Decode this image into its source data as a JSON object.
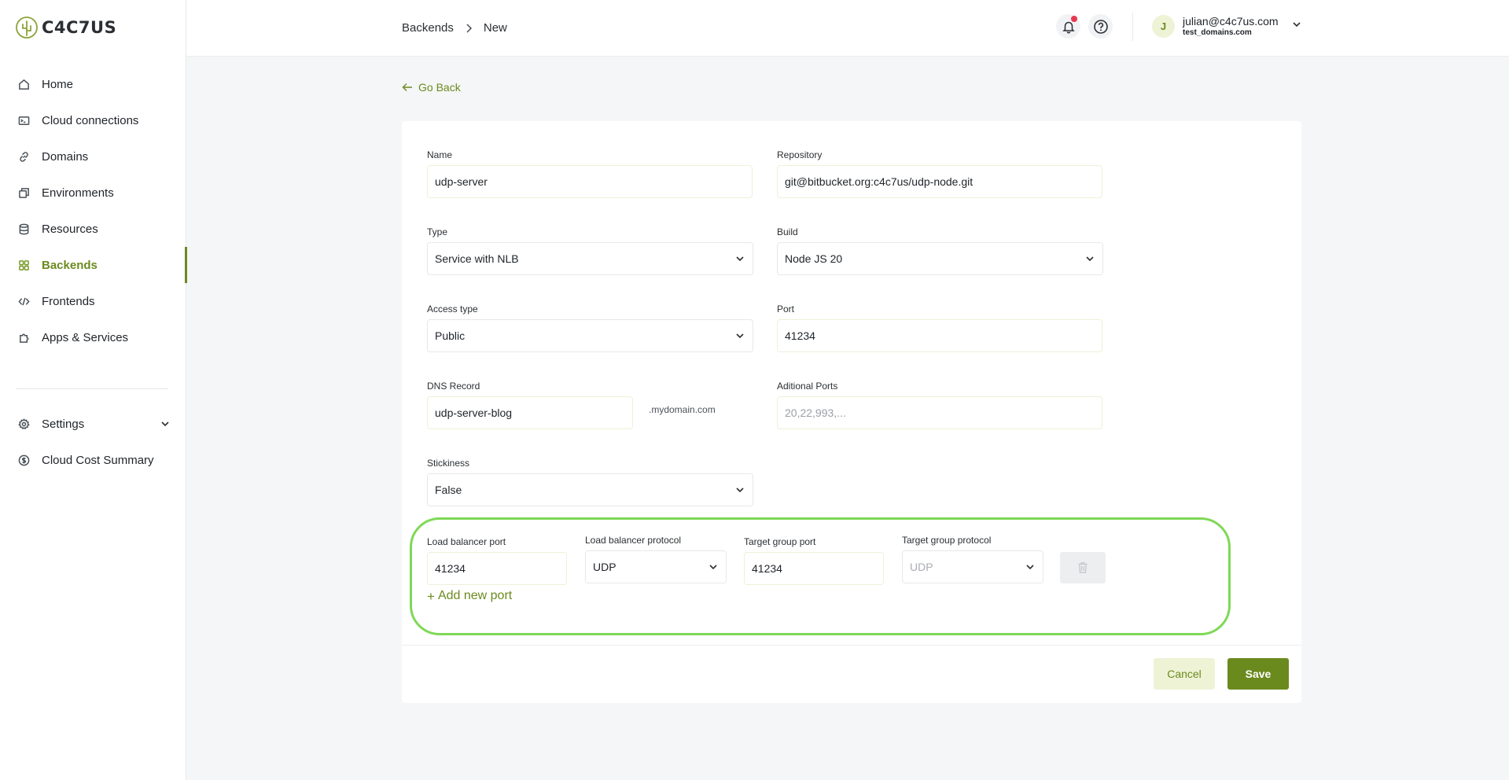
{
  "app": {
    "logo_text": "C4C7US"
  },
  "sidebar": {
    "items": [
      {
        "label": "Home",
        "icon": "home-icon"
      },
      {
        "label": "Cloud connections",
        "icon": "terminal-icon"
      },
      {
        "label": "Domains",
        "icon": "link-icon"
      },
      {
        "label": "Environments",
        "icon": "layers-icon"
      },
      {
        "label": "Resources",
        "icon": "database-icon"
      },
      {
        "label": "Backends",
        "icon": "grid-icon",
        "active": true
      },
      {
        "label": "Frontends",
        "icon": "code-icon"
      },
      {
        "label": "Apps & Services",
        "icon": "puzzle-icon"
      }
    ],
    "secondary": [
      {
        "label": "Settings",
        "icon": "gear-icon"
      },
      {
        "label": "Cloud Cost Summary",
        "icon": "dollar-icon"
      }
    ]
  },
  "header": {
    "breadcrumb": [
      "Backends",
      "New"
    ],
    "user": {
      "initial": "J",
      "email": "julian@c4c7us.com",
      "domain": "test_domains.com"
    }
  },
  "form": {
    "go_back": "Go Back",
    "name": {
      "label": "Name",
      "value": "udp-server"
    },
    "repository": {
      "label": "Repository",
      "value": "git@bitbucket.org:c4c7us/udp-node.git"
    },
    "type": {
      "label": "Type",
      "value": "Service with NLB"
    },
    "build": {
      "label": "Build",
      "value": "Node JS 20"
    },
    "access_type": {
      "label": "Access type",
      "value": "Public"
    },
    "port": {
      "label": "Port",
      "value": "41234"
    },
    "dns_record": {
      "label": "DNS Record",
      "value": "udp-server-blog",
      "suffix": ".mydomain.com"
    },
    "additional_ports": {
      "label": "Aditional Ports",
      "placeholder": "20,22,993,..."
    },
    "stickiness": {
      "label": "Stickiness",
      "value": "False"
    },
    "port_mapping": {
      "lb_port": {
        "label": "Load balancer port",
        "value": "41234"
      },
      "lb_protocol": {
        "label": "Load balancer protocol",
        "value": "UDP"
      },
      "tg_port": {
        "label": "Target group port",
        "value": "41234"
      },
      "tg_protocol": {
        "label": "Target group protocol",
        "value": "UDP"
      }
    },
    "add_new_port": "Add new port",
    "cancel": "Cancel",
    "save": "Save"
  },
  "colors": {
    "accent": "#6b8a1e",
    "highlight": "#7ed957",
    "notification": "#e6394f"
  }
}
